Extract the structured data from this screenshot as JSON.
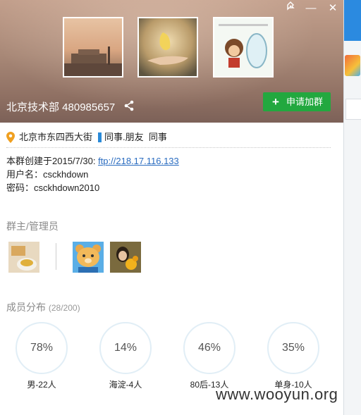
{
  "window": {
    "pin_icon": "pin-icon",
    "minimize_icon": "minimize-icon",
    "close_icon": "close-icon",
    "minimize_glyph": "—",
    "close_glyph": "✕"
  },
  "header": {
    "group_name": "北京技术部 480985657",
    "share_icon": "share-icon",
    "join_button": "申请加群",
    "join_plus": "+",
    "photos": [
      "photo-building",
      "photo-leaf-hand",
      "photo-cartoon-mirror"
    ]
  },
  "info": {
    "location": "北京市东四西大街",
    "tags": "同事.朋友  同事",
    "created_prefix": "本群创建于2015/7/30:",
    "ftp_link": "ftp://218.17.116.133",
    "username": "用户名：csckhdown",
    "password": "密码：csckhdown2010"
  },
  "admins": {
    "title": "群主/管理员",
    "avatars": [
      "avatar-breakfast",
      "avatar-bear",
      "avatar-woman-flowers"
    ]
  },
  "members": {
    "title": "成员分布",
    "count": "(28/200)",
    "stats": [
      {
        "percent": "78%",
        "label": "男-22人"
      },
      {
        "percent": "14%",
        "label": "海淀-4人"
      },
      {
        "percent": "46%",
        "label": "80后-13人"
      },
      {
        "percent": "35%",
        "label": "单身-10人"
      }
    ]
  },
  "watermark": "www.wooyun.org",
  "colors": {
    "join_button": "#22a83f",
    "tag_bar": "#2a8ad8",
    "link": "#2a6cc0",
    "location_pin": "#f0a020",
    "circle_border": "#e1eef6"
  }
}
